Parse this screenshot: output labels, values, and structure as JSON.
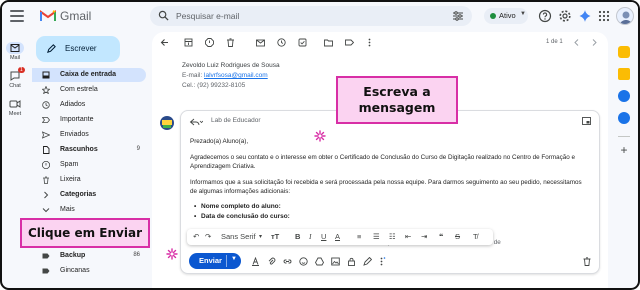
{
  "app": {
    "name": "Gmail"
  },
  "search": {
    "placeholder": "Pesquisar e-mail"
  },
  "status": {
    "label": "Ativo",
    "color": "#1e8e3e"
  },
  "rail": {
    "items": [
      {
        "label": "Mail",
        "icon": "mail-icon"
      },
      {
        "label": "Chat",
        "icon": "chat-icon",
        "badge": "1"
      },
      {
        "label": "Meet",
        "icon": "meet-icon"
      }
    ]
  },
  "compose": {
    "label": "Escrever"
  },
  "nav": {
    "items": [
      {
        "label": "Caixa de entrada",
        "icon": "inbox-icon",
        "active": true,
        "bold": true,
        "count": ""
      },
      {
        "label": "Com estrela",
        "icon": "star-icon",
        "bold": false,
        "count": ""
      },
      {
        "label": "Adiados",
        "icon": "clock-icon",
        "bold": false,
        "count": ""
      },
      {
        "label": "Importante",
        "icon": "important-icon",
        "bold": false,
        "count": ""
      },
      {
        "label": "Enviados",
        "icon": "send-icon",
        "bold": false,
        "count": ""
      },
      {
        "label": "Rascunhos",
        "icon": "draft-icon",
        "bold": true,
        "count": "9"
      },
      {
        "label": "Spam",
        "icon": "spam-icon",
        "bold": false,
        "count": ""
      },
      {
        "label": "Lixeira",
        "icon": "trash-icon",
        "bold": false,
        "count": ""
      },
      {
        "label": "Categorias",
        "icon": "expand-icon",
        "bold": true,
        "count": ""
      },
      {
        "label": "Mais",
        "icon": "chevron-down-icon",
        "bold": false,
        "count": ""
      }
    ],
    "labels": [
      {
        "label": "Backup",
        "icon": "label-icon",
        "count": "86"
      },
      {
        "label": "Gincanas",
        "icon": "label-icon",
        "count": ""
      }
    ]
  },
  "message": {
    "pager": "1 de 1",
    "signature": {
      "name": "Zevoldo Luiz Rodrigues de Sousa",
      "email_prefix": "E-mail: ",
      "email": "lalvrfsosa@gmail.com",
      "phone": "Cel.: (92) 99232-8105"
    }
  },
  "reply": {
    "to": "Lab de Educador",
    "paragraphs": [
      "Prezado(a) Aluno(a),",
      "Agradecemos o seu contato e o interesse em obter o Certificado de Conclusão do Curso de Digitação realizado no Centro de Formação e Aprendizagem Criativa.",
      "Informamos que a sua solicitação foi recebida e será processada pela nossa equipe. Para darmos seguimento ao seu pedido, necessitamos de algumas informações adicionais:"
    ],
    "bullets": [
      "Nome completo do aluno:",
      "Data de conclusão do curso:"
    ],
    "obscured_line": "... processo de emissão do certificado é de",
    "format": {
      "font": "Sans Serif"
    },
    "send_label": "Enviar"
  },
  "annotations": {
    "write": "Escreva a mensagem",
    "send": "Clique em Enviar",
    "accent": "#d82fa6",
    "fill": "#fbd3f1"
  }
}
